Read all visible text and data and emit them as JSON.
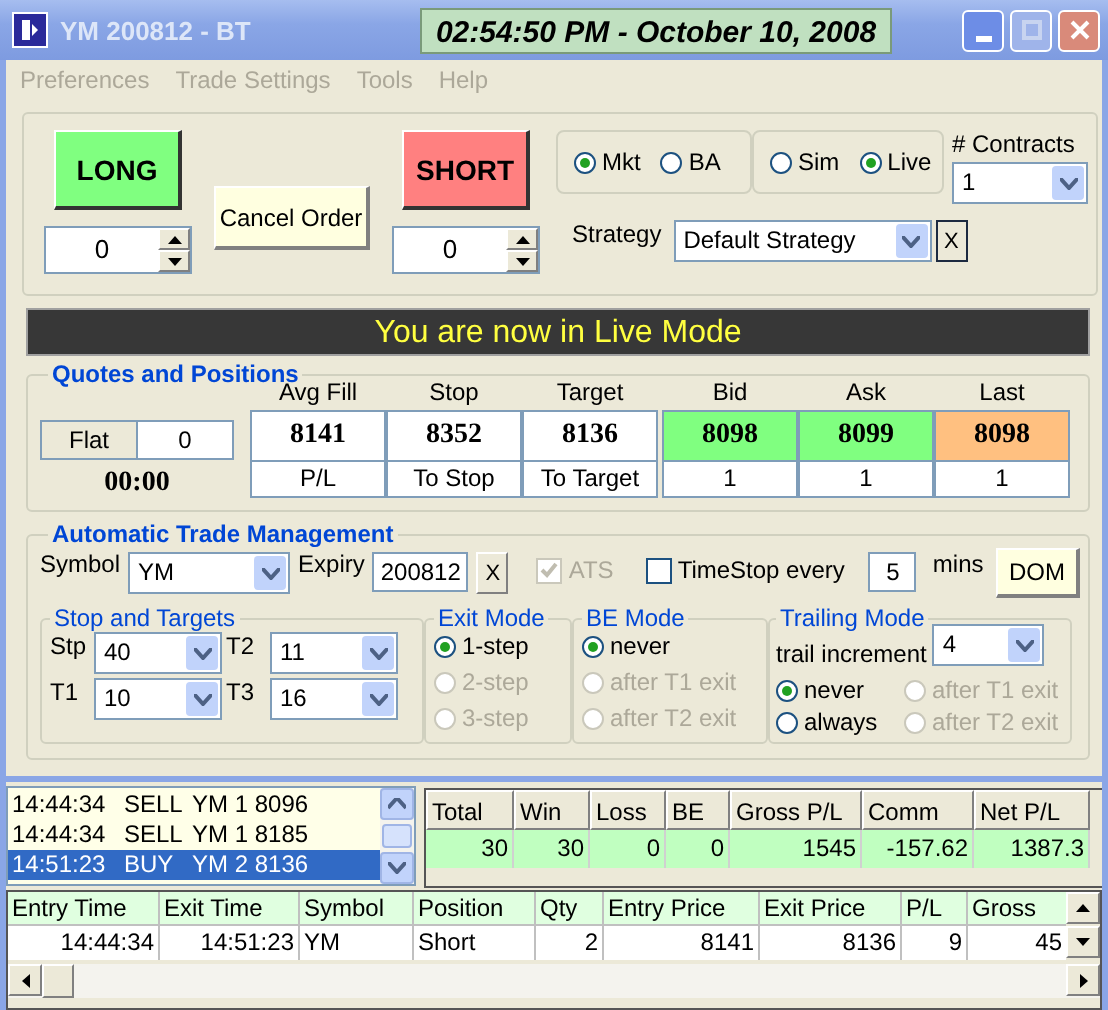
{
  "window": {
    "title": "YM 200812 - BT",
    "clock": "02:54:50 PM - October 10, 2008"
  },
  "menu": [
    {
      "label": "Preferences",
      "disabled": true
    },
    {
      "label": "Trade Settings",
      "disabled": true
    },
    {
      "label": "Tools",
      "disabled": true
    },
    {
      "label": "Help",
      "disabled": true
    }
  ],
  "order_panel": {
    "long_button": "LONG",
    "long_qty": "0",
    "cancel_button": "Cancel Order",
    "short_button": "SHORT",
    "short_qty": "0",
    "order_type": [
      {
        "label": "Mkt",
        "selected": true
      },
      {
        "label": "BA",
        "selected": false
      }
    ],
    "mode": [
      {
        "label": "Sim",
        "selected": false
      },
      {
        "label": "Live",
        "selected": true
      }
    ],
    "contracts_label": "# Contracts",
    "contracts": "1",
    "strategy_label": "Strategy",
    "strategy": "Default Strategy",
    "strategy_clear": "X"
  },
  "banner": "You are now in Live Mode",
  "quotes": {
    "title": "Quotes and Positions",
    "position": "Flat",
    "position_qty": "0",
    "timer": "00:00",
    "columns": [
      {
        "heading": "Avg Fill",
        "value": "8141",
        "sub": "P/L",
        "color": "#ffffff"
      },
      {
        "heading": "Stop",
        "value": "8352",
        "sub": "To Stop",
        "color": "#ffffff"
      },
      {
        "heading": "Target",
        "value": "8136",
        "sub": "To Target",
        "color": "#ffffff"
      },
      {
        "heading": "Bid",
        "value": "8098",
        "sub": "1",
        "color": "#80ff80"
      },
      {
        "heading": "Ask",
        "value": "8099",
        "sub": "1",
        "color": "#80ff80"
      },
      {
        "heading": "Last",
        "value": "8098",
        "sub": "1",
        "color": "#ffc080"
      }
    ]
  },
  "atm": {
    "title": "Automatic Trade Management",
    "symbol_label": "Symbol",
    "symbol": "YM",
    "expiry_label": "Expiry",
    "expiry": "200812",
    "expiry_clear": "X",
    "ats": {
      "label": "ATS",
      "checked": true,
      "disabled": true
    },
    "timestop": {
      "label": "TimeStop every",
      "checked": false
    },
    "timestop_value": "5",
    "timestop_unit": "mins",
    "dom_button": "DOM",
    "stops": {
      "title": "Stop and Targets",
      "fields": [
        {
          "label": "Stp",
          "value": "40"
        },
        {
          "label": "T2",
          "value": "11"
        },
        {
          "label": "T1",
          "value": "10"
        },
        {
          "label": "T3",
          "value": "16"
        }
      ]
    },
    "exit_mode": {
      "title": "Exit Mode",
      "options": [
        {
          "label": "1-step",
          "selected": true,
          "disabled": false
        },
        {
          "label": "2-step",
          "selected": false,
          "disabled": true
        },
        {
          "label": "3-step",
          "selected": false,
          "disabled": true
        }
      ]
    },
    "be_mode": {
      "title": "BE Mode",
      "options": [
        {
          "label": "never",
          "selected": true,
          "disabled": false
        },
        {
          "label": "after T1 exit",
          "selected": false,
          "disabled": true
        },
        {
          "label": "after T2 exit",
          "selected": false,
          "disabled": true
        }
      ]
    },
    "trailing_mode": {
      "title": "Trailing Mode",
      "increment_label": "trail increment",
      "increment": "4",
      "options": [
        {
          "label": "never",
          "selected": true,
          "disabled": false
        },
        {
          "label": "after T1 exit",
          "selected": false,
          "disabled": true
        },
        {
          "label": "always",
          "selected": false,
          "disabled": false
        },
        {
          "label": "after T2 exit",
          "selected": false,
          "disabled": true
        }
      ]
    }
  },
  "order_log": [
    {
      "time": "14:44:34",
      "side": "SELL",
      "detail": "YM 1 8096",
      "selected": false
    },
    {
      "time": "14:44:34",
      "side": "SELL",
      "detail": "YM 1 8185",
      "selected": false
    },
    {
      "time": "14:51:23",
      "side": "BUY",
      "detail": "YM 2 8136",
      "selected": true
    }
  ],
  "stats": {
    "columns": [
      "Total",
      "Win",
      "Loss",
      "BE",
      "Gross P/L",
      "Comm",
      "Net P/L"
    ],
    "values": [
      "30",
      "30",
      "0",
      "0",
      "1545",
      "-157.62",
      "1387.3"
    ]
  },
  "trades": {
    "columns": [
      "Entry Time",
      "Exit Time",
      "Symbol",
      "Position",
      "Qty",
      "Entry Price",
      "Exit Price",
      "P/L",
      "Gross"
    ],
    "rows": [
      [
        "14:44:34",
        "14:51:23",
        "YM",
        "Short",
        "2",
        "8141",
        "8136",
        "9",
        "45"
      ]
    ]
  }
}
